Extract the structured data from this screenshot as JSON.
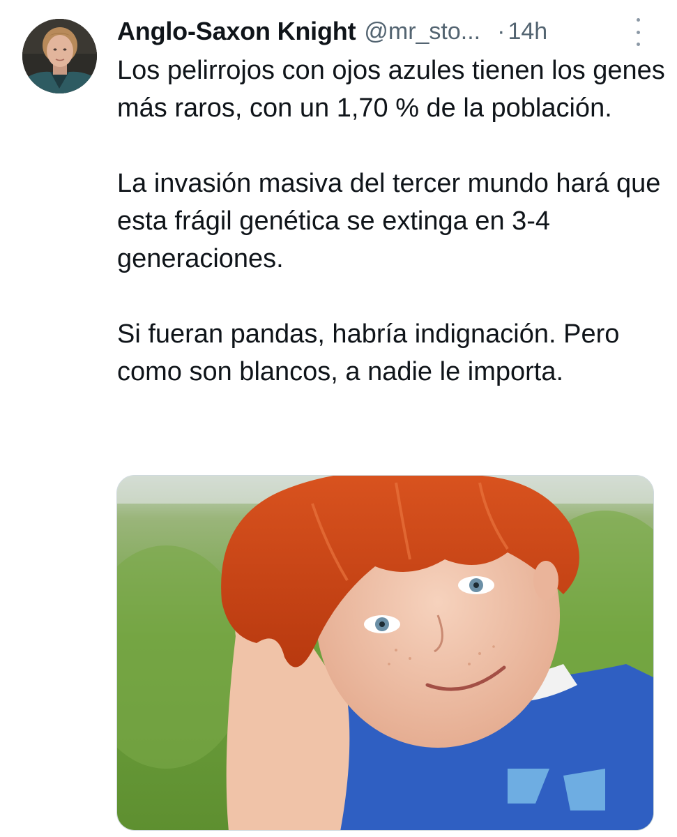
{
  "author": {
    "display_name": "Anglo-Saxon Knight",
    "handle": "@mr_sto...",
    "separator": "·",
    "time": "14h"
  },
  "tweet": {
    "paragraphs": [
      "Los pelirrojos con ojos azules tienen los genes más raros, con un 1,70 % de la población.",
      "La invasión masiva del tercer mundo hará que esta frágil genética se extinga en 3-4 generaciones.",
      "Si fueran pandas, habría indignación. Pero como son blancos, a nadie le importa."
    ]
  },
  "icons": {
    "more": "more-vertical-icon"
  },
  "colors": {
    "text_primary": "#0f1419",
    "text_secondary": "#536471",
    "media_border": "#cfd9de"
  }
}
